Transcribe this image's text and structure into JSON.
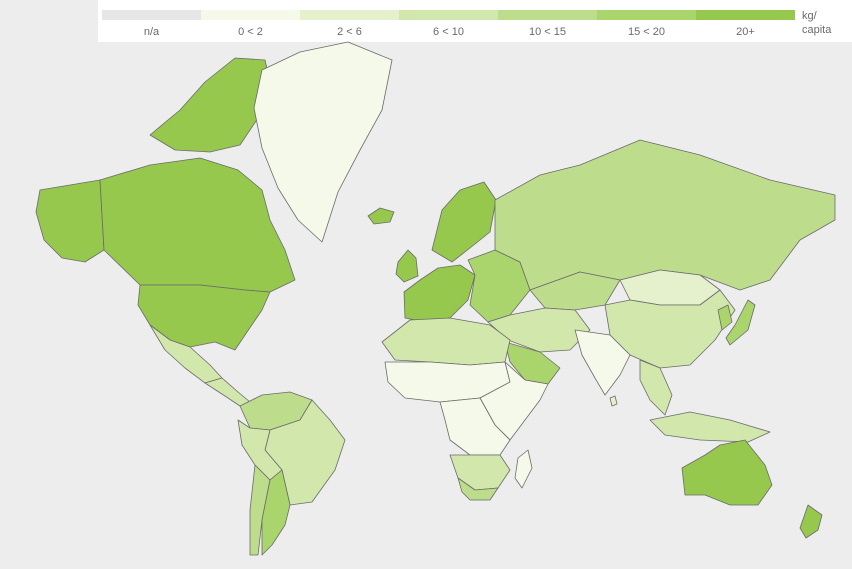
{
  "legend": {
    "unit_line1": "kg/",
    "unit_line2": "capita",
    "bins": [
      {
        "label": "n/a",
        "color": "#e6e6e6"
      },
      {
        "label": "0 < 2",
        "color": "#f5f9ea"
      },
      {
        "label": "2 < 6",
        "color": "#e5f0cc"
      },
      {
        "label": "6 < 10",
        "color": "#d2e7ac"
      },
      {
        "label": "10 < 15",
        "color": "#bedd8c"
      },
      {
        "label": "15 < 20",
        "color": "#aad56c"
      },
      {
        "label": "20+",
        "color": "#95c84c"
      }
    ]
  },
  "regions": [
    {
      "name": "canada",
      "bin": 6
    },
    {
      "name": "usa",
      "bin": 6
    },
    {
      "name": "alaska",
      "bin": 6
    },
    {
      "name": "arctic-islands",
      "bin": 6
    },
    {
      "name": "greenland",
      "bin": 1
    },
    {
      "name": "iceland",
      "bin": 6
    },
    {
      "name": "mexico",
      "bin": 3
    },
    {
      "name": "central-america",
      "bin": 3
    },
    {
      "name": "colombia-venezuela",
      "bin": 4
    },
    {
      "name": "brazil",
      "bin": 3
    },
    {
      "name": "peru-bolivia",
      "bin": 3
    },
    {
      "name": "argentina",
      "bin": 5
    },
    {
      "name": "chile",
      "bin": 4
    },
    {
      "name": "western-europe",
      "bin": 6
    },
    {
      "name": "uk-ireland",
      "bin": 6
    },
    {
      "name": "scandinavia",
      "bin": 6
    },
    {
      "name": "eastern-europe",
      "bin": 5
    },
    {
      "name": "russia",
      "bin": 4
    },
    {
      "name": "kazakhstan",
      "bin": 4
    },
    {
      "name": "middle-east",
      "bin": 3
    },
    {
      "name": "saudi-arabia",
      "bin": 5
    },
    {
      "name": "north-africa",
      "bin": 3
    },
    {
      "name": "sahel",
      "bin": 1
    },
    {
      "name": "central-africa",
      "bin": 1
    },
    {
      "name": "east-africa",
      "bin": 1
    },
    {
      "name": "southern-africa",
      "bin": 3
    },
    {
      "name": "south-africa",
      "bin": 4
    },
    {
      "name": "madagascar",
      "bin": 1
    },
    {
      "name": "india",
      "bin": 1
    },
    {
      "name": "china",
      "bin": 3
    },
    {
      "name": "mongolia",
      "bin": 2
    },
    {
      "name": "southeast-asia",
      "bin": 3
    },
    {
      "name": "japan",
      "bin": 5
    },
    {
      "name": "korea",
      "bin": 5
    },
    {
      "name": "indonesia",
      "bin": 3
    },
    {
      "name": "australia",
      "bin": 6
    },
    {
      "name": "new-zealand",
      "bin": 6
    },
    {
      "name": "sri-lanka",
      "bin": 2
    }
  ]
}
